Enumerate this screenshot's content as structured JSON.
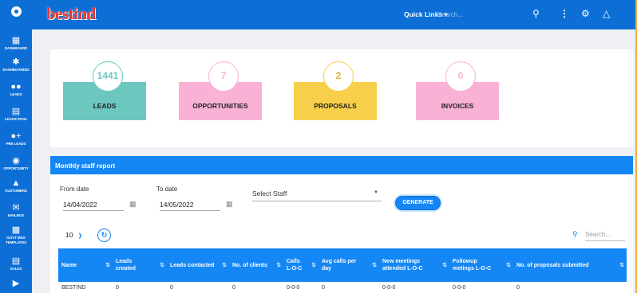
{
  "sidebar": {
    "items": [
      {
        "label": "Dashboard"
      },
      {
        "label": "Dashboard02"
      },
      {
        "label": "Leads"
      },
      {
        "label": "Leads Pool"
      },
      {
        "label": "Pre Leads"
      },
      {
        "label": "Opportunity"
      },
      {
        "label": "Customers"
      },
      {
        "label": "Mailbox"
      },
      {
        "label": "Govt Msg Templates"
      },
      {
        "label": "Sales"
      },
      {
        "label": ""
      }
    ]
  },
  "topbar": {
    "brand": "bestind",
    "quick_links": "Quick Links ▾",
    "search_placeholder": "Search..."
  },
  "summary": {
    "cards": [
      {
        "value": "1441",
        "label": "LEADS",
        "color": "#6cc8bf"
      },
      {
        "value": "7",
        "label": "OPPORTUNITIES",
        "color": "#f9b1d6"
      },
      {
        "value": "2",
        "label": "PROPOSALS",
        "color": "#f7cf4a"
      },
      {
        "value": "0",
        "label": "INVOICES",
        "color": "#f9b1d6"
      }
    ]
  },
  "report": {
    "title": "Monthly staff report",
    "from_label": "From date",
    "from_value": "14/04/2022",
    "to_label": "To date",
    "to_value": "14/05/2022",
    "staff_label": "Select Staff",
    "generate_label": "GENERATE",
    "page_size": "10",
    "search_placeholder": "Search...",
    "columns": [
      "Name",
      "Leads created",
      "Leads contacted",
      "No. of clients",
      "Calls L-O-C",
      "Avg calls per day",
      "New meetings attended L-O-C",
      "Followup metings L-O-C",
      "No. of proposals submitted"
    ],
    "rows": [
      [
        "BESTIND",
        "0",
        "0",
        "0",
        "0-0-0",
        "0",
        "0-0-0",
        "0-0-0",
        "0"
      ]
    ]
  }
}
